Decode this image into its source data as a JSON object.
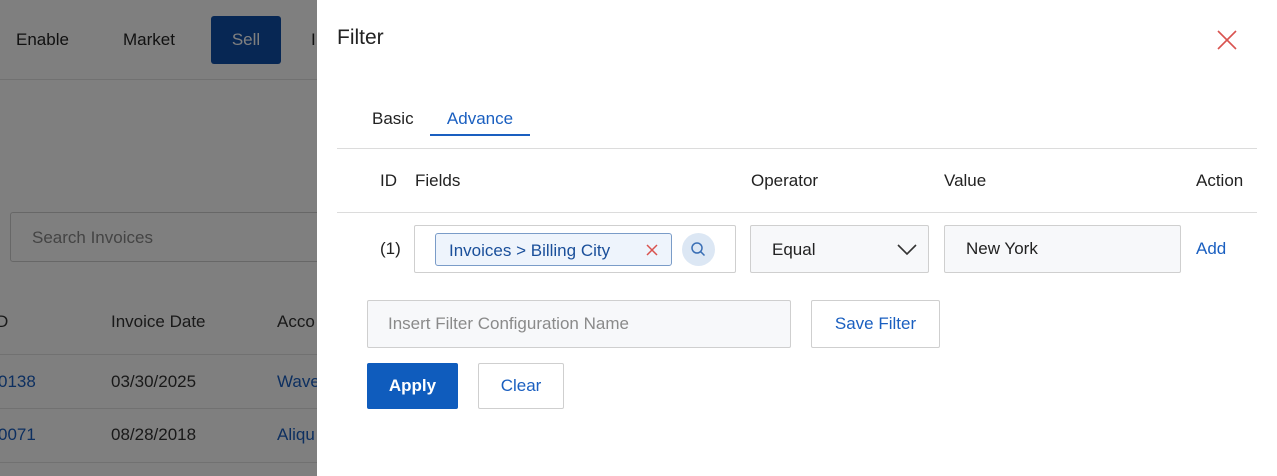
{
  "background": {
    "nav": {
      "items": [
        "Enable",
        "Market",
        "Sell",
        "I"
      ]
    },
    "search": {
      "placeholder": "Search Invoices"
    },
    "table": {
      "columns": [
        "D",
        "Invoice Date",
        "Acco"
      ],
      "rows": [
        {
          "id": "0138",
          "date": "03/30/2025",
          "account": "Wave"
        },
        {
          "id": "0071",
          "date": "08/28/2018",
          "account": "Aliqu"
        }
      ]
    }
  },
  "panel": {
    "title": "Filter",
    "tabs": {
      "basic": "Basic",
      "advance": "Advance"
    },
    "columns": {
      "id": "ID",
      "fields": "Fields",
      "operator": "Operator",
      "value": "Value",
      "action": "Action"
    },
    "row": {
      "index": "(1)",
      "field_chip": "Invoices > Billing City",
      "operator": "Equal",
      "value": "New York",
      "action": "Add"
    },
    "config": {
      "placeholder": "Insert Filter Configuration Name",
      "save_label": "Save Filter"
    },
    "buttons": {
      "apply": "Apply",
      "clear": "Clear"
    }
  },
  "colors": {
    "primary": "#0f5cbd",
    "link": "#1a5fc0",
    "close_icon": "#d9534f"
  },
  "icons": {
    "close": "close-icon",
    "chip_remove": "remove-chip-icon",
    "search": "search-icon",
    "dropdown": "chevron-down-icon"
  }
}
